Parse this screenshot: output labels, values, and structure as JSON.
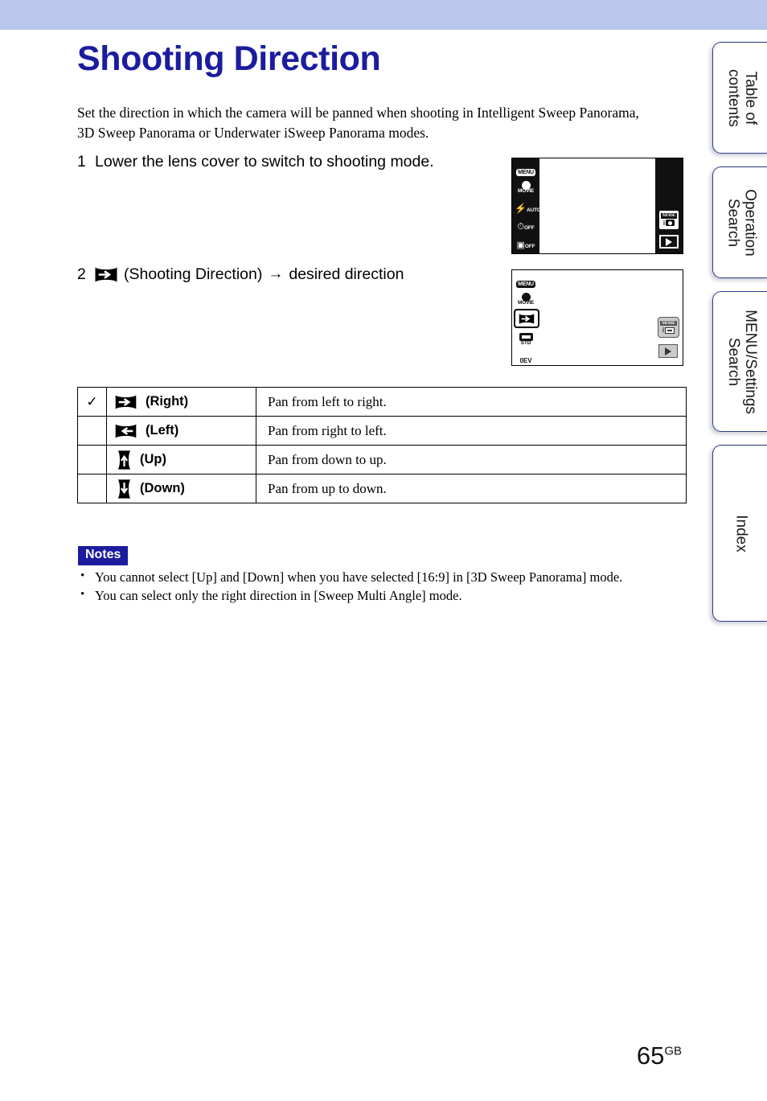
{
  "document": {
    "title": "Shooting Direction",
    "intro": "Set the direction in which the camera will be panned when shooting in Intelligent Sweep Panorama, 3D Sweep Panorama or Underwater iSweep Panorama modes.",
    "page_number": "65",
    "page_number_suffix": "GB",
    "title_color": "#1b1c9e",
    "header_band_color": "#b9c7ec"
  },
  "steps": [
    {
      "number": "1",
      "text": "Lower the lens cover to switch to shooting mode.",
      "icon": null
    },
    {
      "number": "2",
      "icon": "shooting-direction-right-icon",
      "text_before_arrow": "(Shooting Direction)",
      "arrow": "→",
      "text_after_arrow": "desired direction"
    }
  ],
  "screens": [
    {
      "name": "shooting-mode-screen",
      "background": "black",
      "left_icons": [
        {
          "name": "menu-icon",
          "label": "MENU"
        },
        {
          "name": "movie-mode-icon",
          "label": "MOVIE"
        },
        {
          "name": "flash-icon",
          "label": "AUTO"
        },
        {
          "name": "self-timer-icon",
          "label": "OFF"
        },
        {
          "name": "burst-icon",
          "label": "OFF"
        }
      ],
      "right_buttons": [
        {
          "name": "mode-button",
          "caption": "MODE",
          "label": "iAUTO"
        },
        {
          "name": "playback-button",
          "label": "▶"
        }
      ]
    },
    {
      "name": "shooting-direction-menu-screen",
      "background": "white",
      "left_icons": [
        {
          "name": "menu-icon",
          "label": "MENU"
        },
        {
          "name": "movie-mode-icon",
          "label": "MOVIE"
        },
        {
          "name": "shooting-direction-icon",
          "label": "",
          "selected": true
        },
        {
          "name": "image-size-icon",
          "label": "STD"
        },
        {
          "name": "exposure-value-icon",
          "label": "0EV"
        }
      ],
      "right_buttons": [
        {
          "name": "mode-button",
          "caption": "MODE",
          "label": ""
        },
        {
          "name": "playback-button",
          "label": "▶"
        }
      ]
    }
  ],
  "options_table": {
    "rows": [
      {
        "default": true,
        "check_glyph": "✓",
        "icon": "direction-right-icon",
        "label": "(Right)",
        "description": "Pan from left to right."
      },
      {
        "default": false,
        "check_glyph": "",
        "icon": "direction-left-icon",
        "label": "(Left)",
        "description": "Pan from right to left."
      },
      {
        "default": false,
        "check_glyph": "",
        "icon": "direction-up-icon",
        "label": "(Up)",
        "description": "Pan from down to up."
      },
      {
        "default": false,
        "check_glyph": "",
        "icon": "direction-down-icon",
        "label": "(Down)",
        "description": "Pan from up to down."
      }
    ]
  },
  "notes": {
    "heading": "Notes",
    "items": [
      "You cannot select [Up] and [Down] when you have selected [16:9] in [3D Sweep Panorama] mode.",
      "You can select only the right direction in [Sweep Multi Angle] mode."
    ]
  },
  "side_tabs": [
    {
      "label": "Table of\ncontents",
      "line1": "Table of",
      "line2": "contents"
    },
    {
      "label": "Operation\nSearch",
      "line1": "Operation",
      "line2": "Search"
    },
    {
      "label": "MENU/Settings\nSearch",
      "line1": "MENU/Settings",
      "line2": "Search"
    },
    {
      "label": "Index",
      "line1": "Index",
      "line2": ""
    }
  ]
}
